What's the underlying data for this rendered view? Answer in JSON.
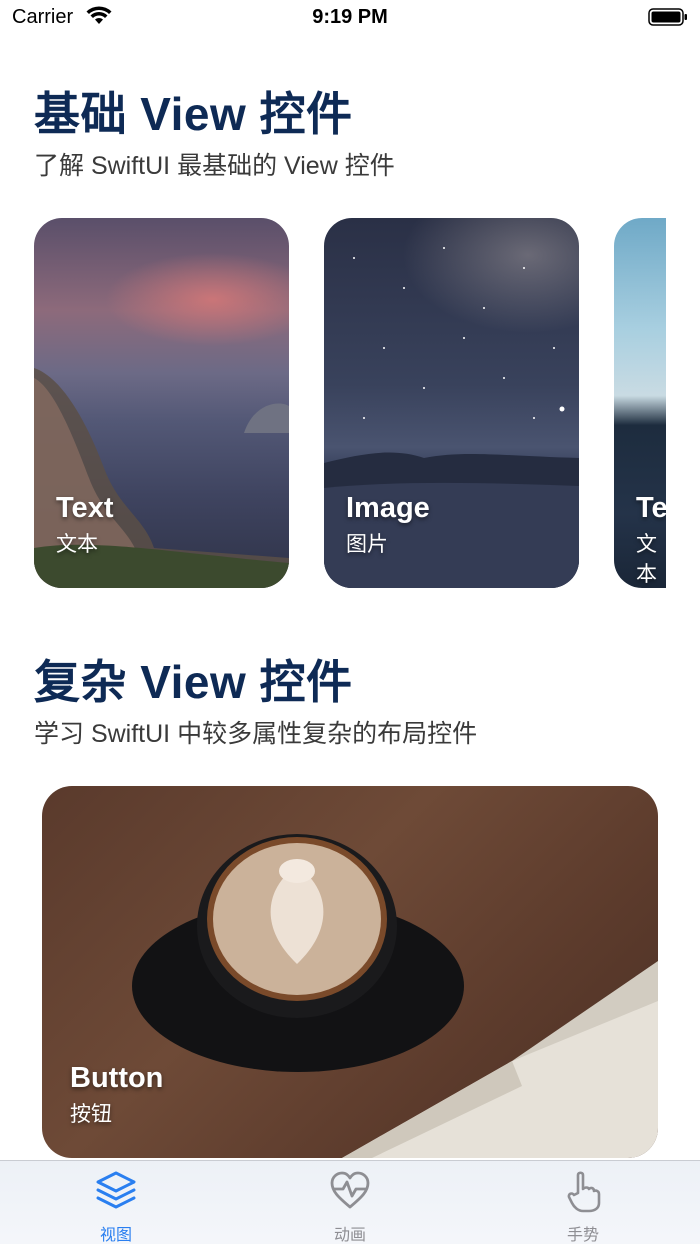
{
  "status_bar": {
    "carrier": "Carrier",
    "time": "9:19 PM"
  },
  "sections": [
    {
      "title": "基础 View 控件",
      "subtitle": "了解 SwiftUI 最基础的 View 控件"
    },
    {
      "title": "复杂 View 控件",
      "subtitle": "学习 SwiftUI 中较多属性复杂的布局控件"
    }
  ],
  "basic_cards": [
    {
      "title": "Text",
      "subtitle": "文本"
    },
    {
      "title": "Image",
      "subtitle": "图片"
    },
    {
      "title": "Te",
      "subtitle": "文本"
    }
  ],
  "complex_cards": [
    {
      "title": "Button",
      "subtitle": "按钮"
    }
  ],
  "tabs": [
    {
      "label": "视图",
      "icon": "layers-icon",
      "selected": true
    },
    {
      "label": "动画",
      "icon": "heart-pulse-icon",
      "selected": false
    },
    {
      "label": "手势",
      "icon": "hand-point-icon",
      "selected": false
    }
  ],
  "colors": {
    "accent": "#2a7ff0",
    "heading": "#0e2a55",
    "tab_inactive": "#8e8e93"
  }
}
